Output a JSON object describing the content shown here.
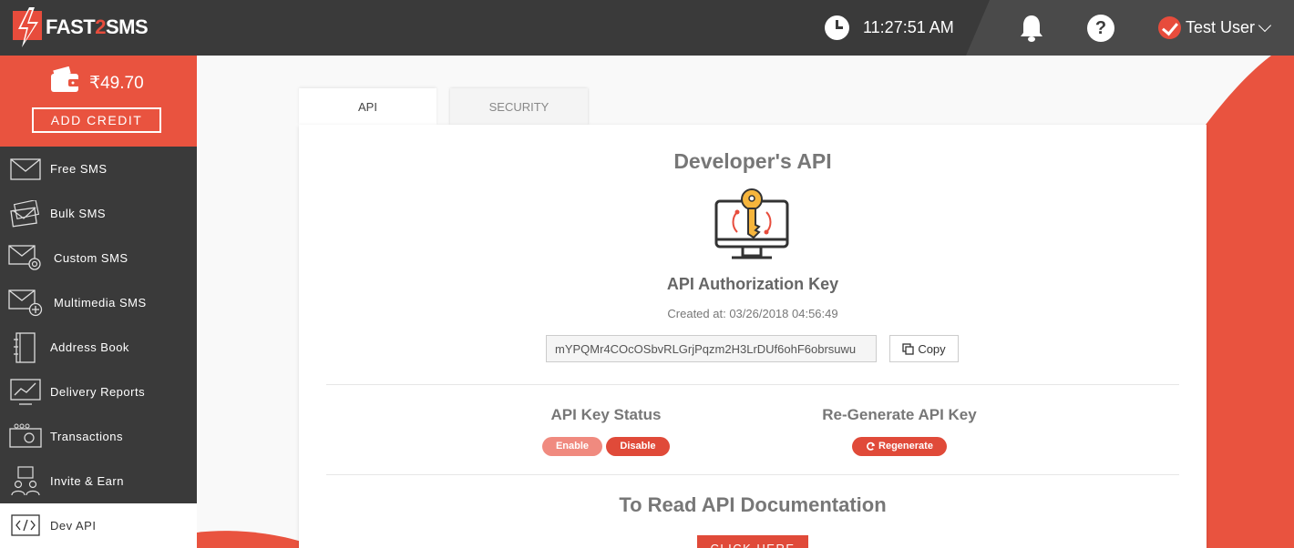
{
  "header": {
    "logo_prefix": "FAST",
    "logo_two": "2",
    "logo_suffix": "SMS",
    "time": "11:27:51 AM",
    "user_name": "Test User"
  },
  "sidebar": {
    "balance": "₹49.70",
    "add_credit": "ADD CREDIT",
    "items": [
      {
        "label": "Free SMS",
        "icon": "envelope-icon"
      },
      {
        "label": "Bulk SMS",
        "icon": "stacked-envelopes-icon"
      },
      {
        "label": "Custom SMS",
        "icon": "envelope-gear-icon"
      },
      {
        "label": "Multimedia SMS",
        "icon": "envelope-plus-icon"
      },
      {
        "label": "Address Book",
        "icon": "address-book-icon"
      },
      {
        "label": "Delivery Reports",
        "icon": "chart-icon"
      },
      {
        "label": "Transactions",
        "icon": "transactions-icon"
      },
      {
        "label": "Invite & Earn",
        "icon": "invite-icon"
      },
      {
        "label": "Dev API",
        "icon": "code-icon"
      }
    ],
    "active_index": 8
  },
  "tabs": [
    {
      "label": "API",
      "active": true
    },
    {
      "label": "SECURITY",
      "active": false
    }
  ],
  "main": {
    "title": "Developer's API",
    "auth_key_title": "API Authorization Key",
    "created_at": "Created at: 03/26/2018 04:56:49",
    "api_key": "mYPQMr4COcOSbvRLGrjPqzm2H3LrDUf6ohF6obrsuwu",
    "copy_label": "Copy",
    "status_title": "API Key Status",
    "enable_label": "Enable",
    "disable_label": "Disable",
    "regen_title": "Re-Generate API Key",
    "regen_label": "Regenerate",
    "docs_title": "To Read API Documentation",
    "click_here": "CLICK HERE"
  },
  "colors": {
    "brand_red": "#e9533f",
    "dark": "#3a3a3a"
  }
}
